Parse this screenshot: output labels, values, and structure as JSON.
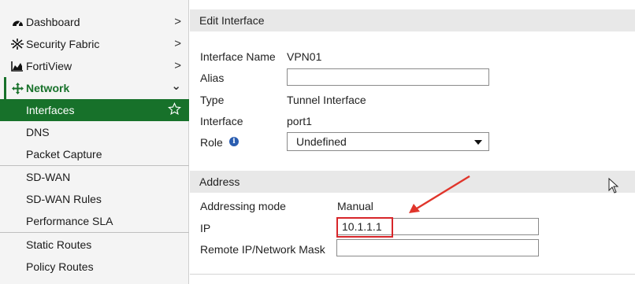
{
  "sidebar": {
    "items": [
      {
        "label": "Dashboard",
        "icon": "dashboard-icon"
      },
      {
        "label": "Security Fabric",
        "icon": "security-fabric-icon"
      },
      {
        "label": "FortiView",
        "icon": "fortiview-icon"
      },
      {
        "label": "Network",
        "icon": "network-icon"
      },
      {
        "label": "Interfaces"
      },
      {
        "label": "DNS"
      },
      {
        "label": "Packet Capture"
      },
      {
        "label": "SD-WAN"
      },
      {
        "label": "SD-WAN Rules"
      },
      {
        "label": "Performance SLA"
      },
      {
        "label": "Static Routes"
      },
      {
        "label": "Policy Routes"
      }
    ],
    "chevron": ">",
    "expanded_chevron": "⌄",
    "active_color": "#17712a"
  },
  "edit_interface": {
    "header": "Edit Interface",
    "interface_name_label": "Interface Name",
    "interface_name_value": "VPN01",
    "alias_label": "Alias",
    "alias_value": "",
    "type_label": "Type",
    "type_value": "Tunnel Interface",
    "interface_label": "Interface",
    "interface_value": "port1",
    "role_label": "Role",
    "role_value": "Undefined"
  },
  "address": {
    "header": "Address",
    "addressing_mode_label": "Addressing mode",
    "addressing_mode_value": "Manual",
    "ip_label": "IP",
    "ip_value": "10.1.1.1",
    "remote_label": "Remote IP/Network Mask",
    "remote_value": ""
  },
  "annotation": {
    "arrow_color": "#e0352b"
  }
}
